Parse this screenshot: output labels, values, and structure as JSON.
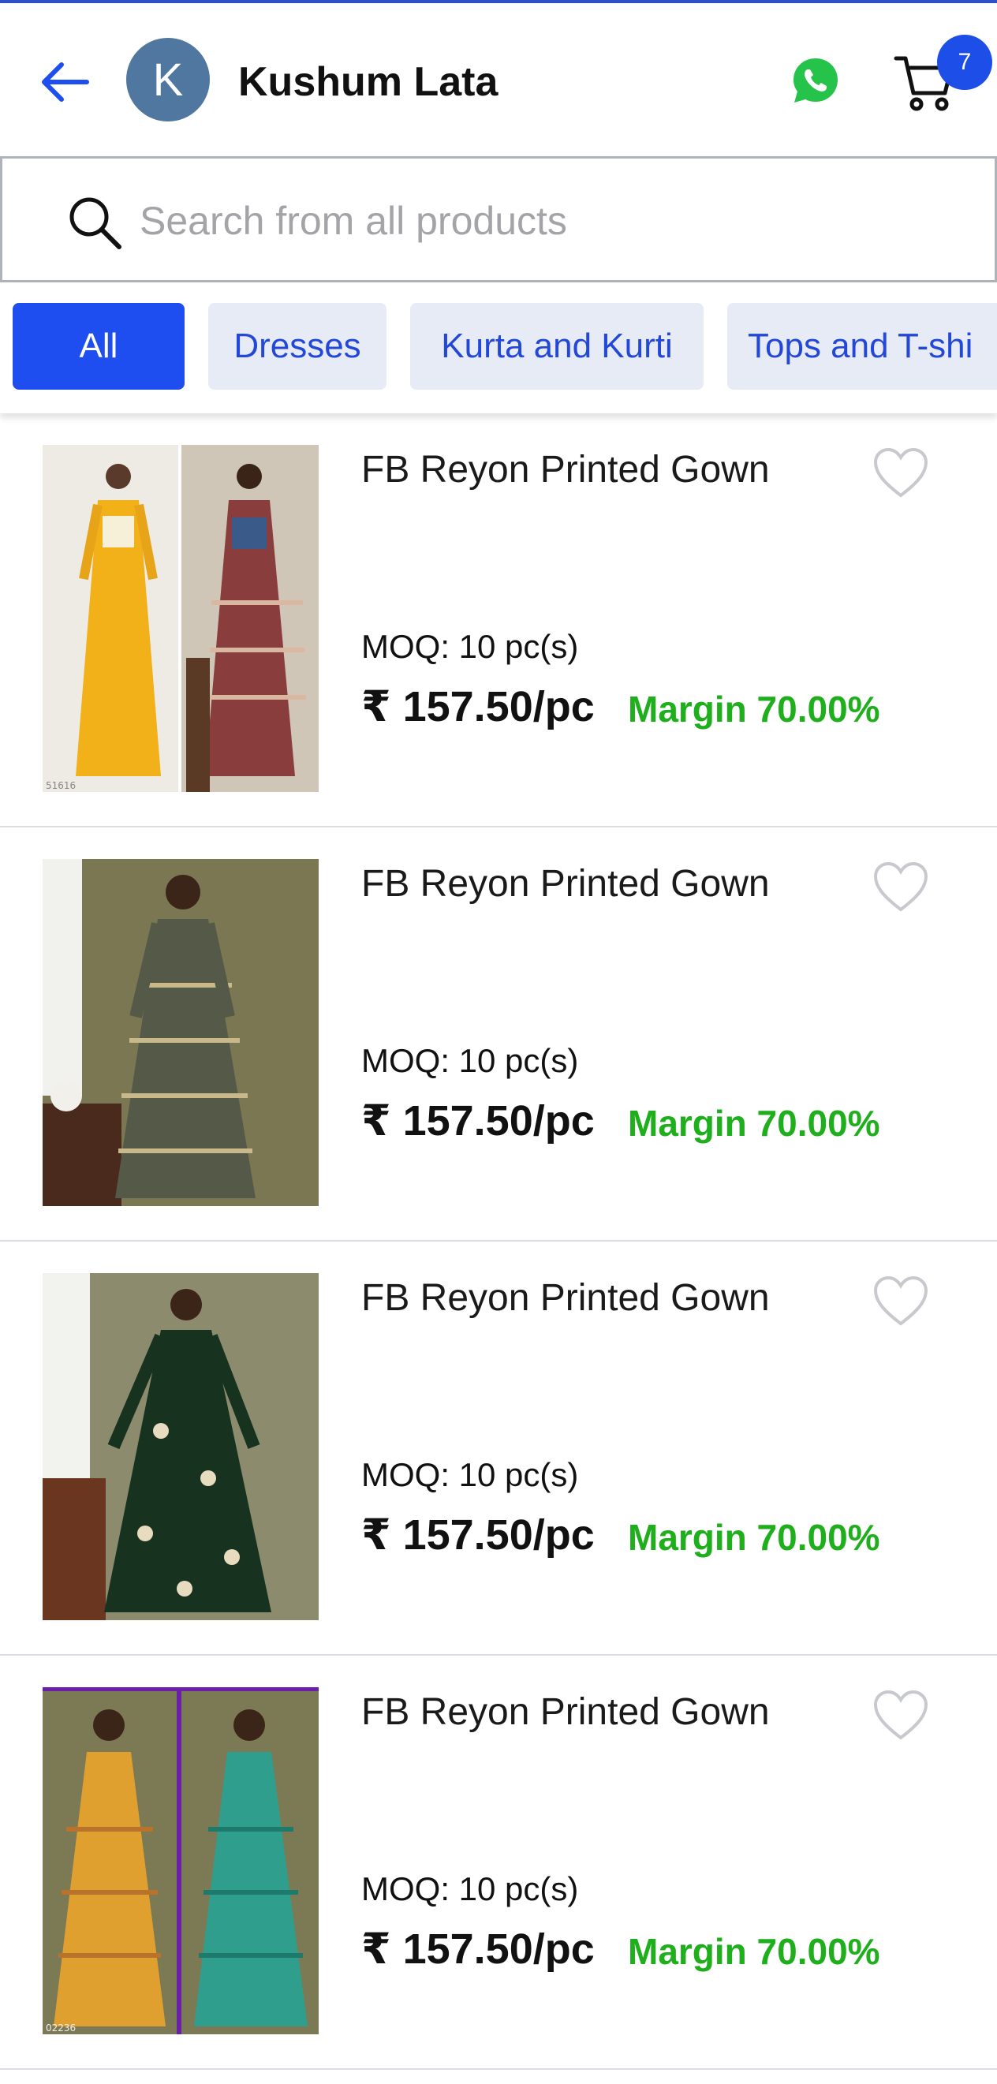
{
  "header": {
    "shop_name": "Kushum Lata",
    "avatar_letter": "K",
    "cart_count": "7",
    "icons": [
      "back-arrow-icon",
      "whatsapp-icon",
      "cart-icon"
    ]
  },
  "search": {
    "placeholder": "Search from all products",
    "icon": "search-icon"
  },
  "categories": {
    "items": [
      {
        "label": "All",
        "active": true
      },
      {
        "label": "Dresses",
        "active": false
      },
      {
        "label": "Kurta and Kurti",
        "active": false
      },
      {
        "label": "Tops and T-shi",
        "active": false
      }
    ]
  },
  "colors": {
    "accent": "#1e4df0",
    "margin_green": "#1fae1c",
    "chip_bg": "#e6ebf5"
  },
  "products": [
    {
      "name": "FB Reyon Printed Gown",
      "moq": "MOQ: 10 pc(s)",
      "price": "₹ 157.50/pc",
      "margin": "Margin 70.00%",
      "image_text": "51616"
    },
    {
      "name": "FB Reyon Printed Gown",
      "moq": "MOQ: 10 pc(s)",
      "price": "₹ 157.50/pc",
      "margin": "Margin 70.00%"
    },
    {
      "name": "FB Reyon Printed Gown",
      "moq": "MOQ: 10 pc(s)",
      "price": "₹ 157.50/pc",
      "margin": "Margin 70.00%"
    },
    {
      "name": "FB Reyon Printed Gown",
      "moq": "MOQ: 10 pc(s)",
      "price": "₹ 157.50/pc",
      "margin": "Margin 70.00%",
      "image_text": "02236"
    }
  ]
}
